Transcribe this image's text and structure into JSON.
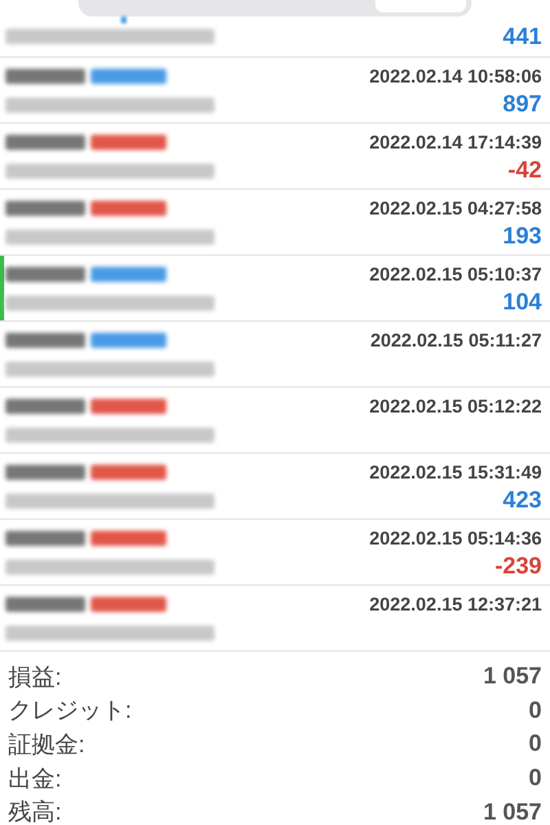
{
  "trades": [
    {
      "kind": "buy",
      "selected": false,
      "partial": true,
      "profit": "441",
      "positive": true
    },
    {
      "kind": "buy",
      "selected": false,
      "partial": false,
      "time": "2022.02.14 10:58:06",
      "profit": "897",
      "positive": true
    },
    {
      "kind": "sell",
      "selected": false,
      "partial": false,
      "time": "2022.02.14 17:14:39",
      "profit": "-42",
      "positive": false
    },
    {
      "kind": "sell",
      "selected": false,
      "partial": false,
      "time": "2022.02.15 04:27:58",
      "profit": "193",
      "positive": true
    },
    {
      "kind": "buy",
      "selected": true,
      "partial": false,
      "time": "2022.02.15 05:10:37",
      "profit": "104",
      "positive": true
    },
    {
      "kind": "buy",
      "selected": false,
      "partial": false,
      "time": "2022.02.15 05:11:27"
    },
    {
      "kind": "sell",
      "selected": false,
      "partial": false,
      "time": "2022.02.15 05:12:22"
    },
    {
      "kind": "sell",
      "selected": false,
      "partial": false,
      "time": "2022.02.15 15:31:49",
      "profit": "423",
      "positive": true
    },
    {
      "kind": "sell",
      "selected": false,
      "partial": false,
      "time": "2022.02.15 05:14:36",
      "profit": "-239",
      "positive": false
    },
    {
      "kind": "sell",
      "selected": false,
      "partial": false,
      "time": "2022.02.15 12:37:21"
    }
  ],
  "totals": [
    {
      "label": "損益:",
      "value": "1 057"
    },
    {
      "label": "クレジット:",
      "value": "0"
    },
    {
      "label": "証拠金:",
      "value": "0"
    },
    {
      "label": "出金:",
      "value": "0"
    },
    {
      "label": "残高:",
      "value": "1 057"
    }
  ]
}
